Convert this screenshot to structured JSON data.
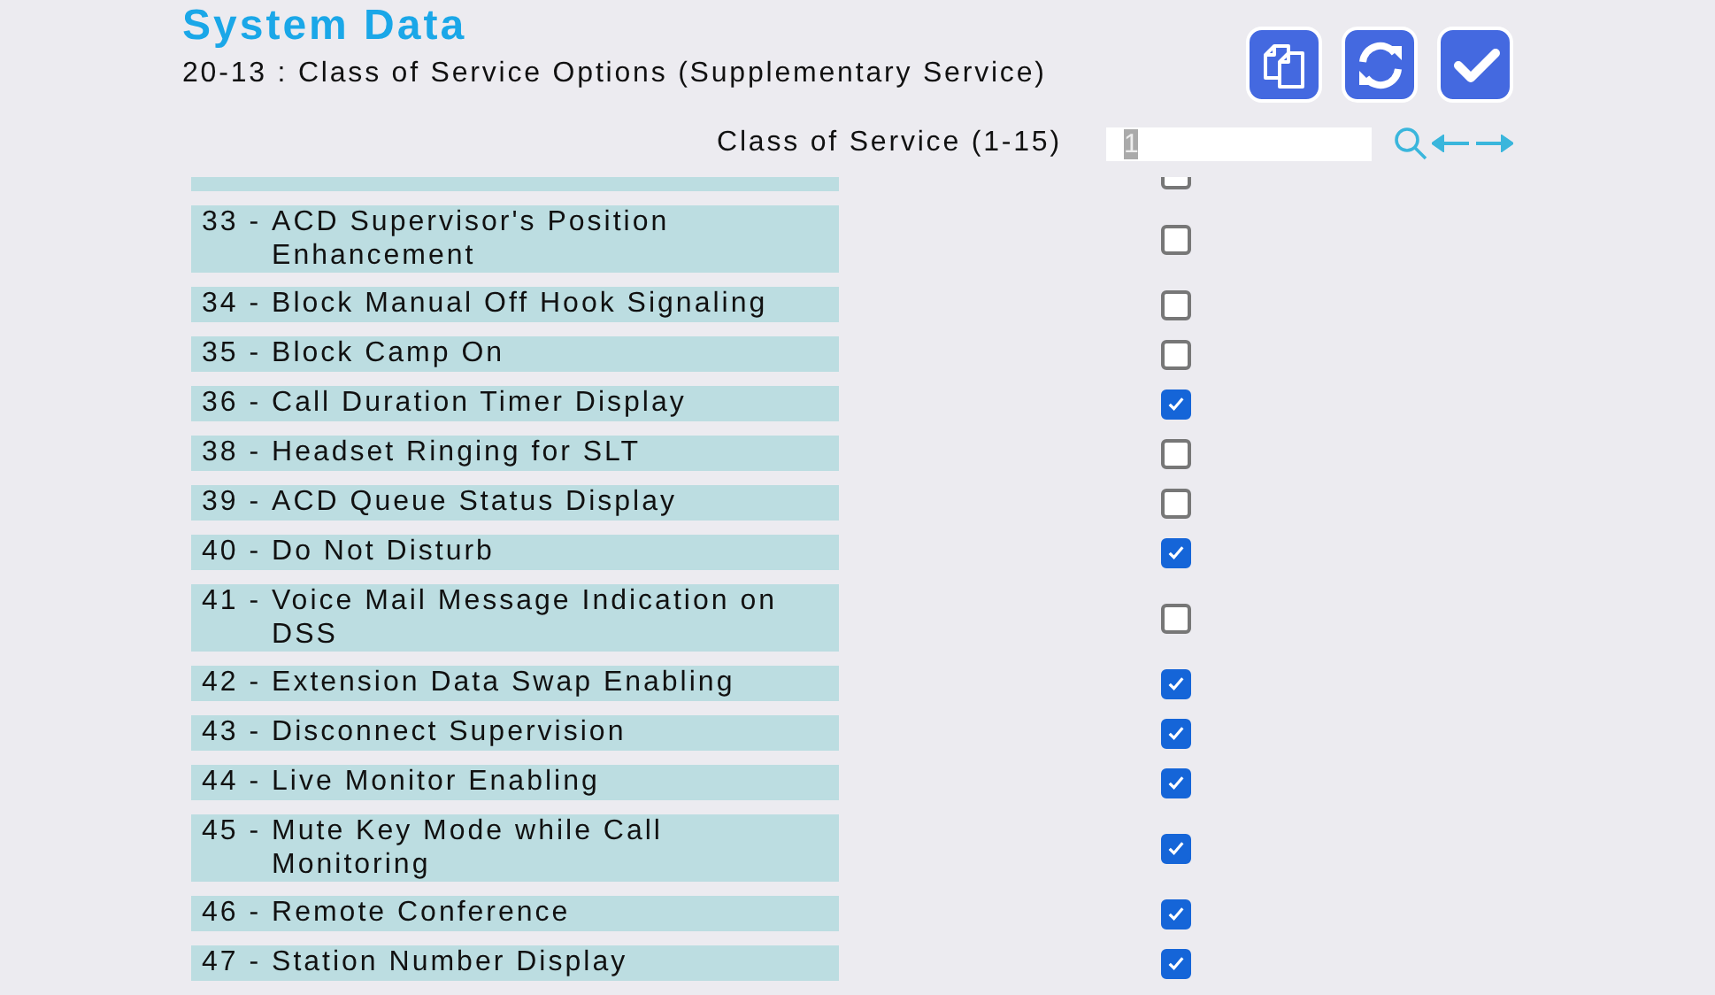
{
  "header": {
    "title": "System Data",
    "subtitle": "20-13 : Class of Service Options (Supplementary Service)"
  },
  "toolbar": {
    "buttons": [
      {
        "kind": "copy"
      },
      {
        "kind": "refresh"
      },
      {
        "kind": "apply"
      }
    ]
  },
  "selector": {
    "label": "Class of Service (1-15)",
    "value": "1"
  },
  "options": [
    {
      "checked": false
    },
    {
      "label": "33 - ACD Supervisor's Position Enhancement",
      "checked": false
    },
    {
      "label": "34 - Block Manual Off Hook Signaling",
      "checked": false
    },
    {
      "label": "35 - Block Camp On",
      "checked": false
    },
    {
      "label": "36 - Call Duration Timer Display",
      "checked": true
    },
    {
      "label": "38 - Headset Ringing for SLT",
      "checked": false
    },
    {
      "label": "39 - ACD Queue Status Display",
      "checked": false
    },
    {
      "label": "40 - Do Not Disturb",
      "checked": true
    },
    {
      "label": "41 - Voice Mail Message Indication on DSS",
      "checked": false
    },
    {
      "label": "42 - Extension Data Swap Enabling",
      "checked": true
    },
    {
      "label": "43 - Disconnect Supervision",
      "checked": true
    },
    {
      "label": "44 - Live Monitor Enabling",
      "checked": true
    },
    {
      "label": "45 - Mute Key Mode while Call Monitoring",
      "checked": true
    },
    {
      "label": "46 - Remote Conference",
      "checked": true
    },
    {
      "label": "47 - Station Number Display",
      "checked": true
    }
  ]
}
